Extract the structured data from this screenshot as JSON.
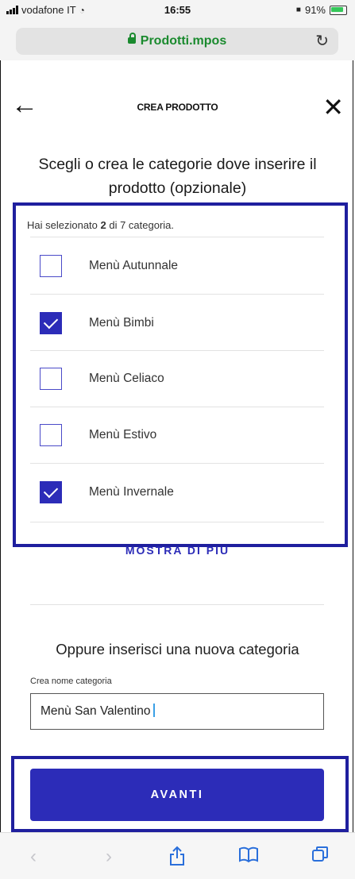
{
  "status_bar": {
    "carrier": "vodafone IT",
    "time": "16:55",
    "battery": "91%"
  },
  "browser": {
    "url": "Prodotti.mpos"
  },
  "header": {
    "title": "CREA PRODOTTO"
  },
  "headline": "Scegli o crea le categorie dove inserire il prodotto (opzionale)",
  "selection": {
    "prefix": "Hai selezionato ",
    "selected": "2",
    "suffix": " di 7 categoria."
  },
  "categories": [
    {
      "label": "Menù Autunnale",
      "checked": false
    },
    {
      "label": "Menù Bimbi",
      "checked": true
    },
    {
      "label": "Menù Celiaco",
      "checked": false
    },
    {
      "label": "Menù Estivo",
      "checked": false
    },
    {
      "label": "Menù Invernale",
      "checked": true
    }
  ],
  "show_more": "MOSTRA DI PIÙ",
  "new_category": {
    "heading": "Oppure inserisci una nuova categoria",
    "label": "Crea nome categoria",
    "value": "Menù San Valentino"
  },
  "primary_button": "AVANTI",
  "colors": {
    "primary": "#2c2cb8",
    "highlight_border": "#1f1f9e",
    "url_green": "#1a8a2e"
  },
  "icons": [
    "back-arrow-icon",
    "close-icon",
    "lock-icon",
    "reload-icon",
    "share-icon",
    "bookmarks-icon",
    "tabs-icon"
  ]
}
